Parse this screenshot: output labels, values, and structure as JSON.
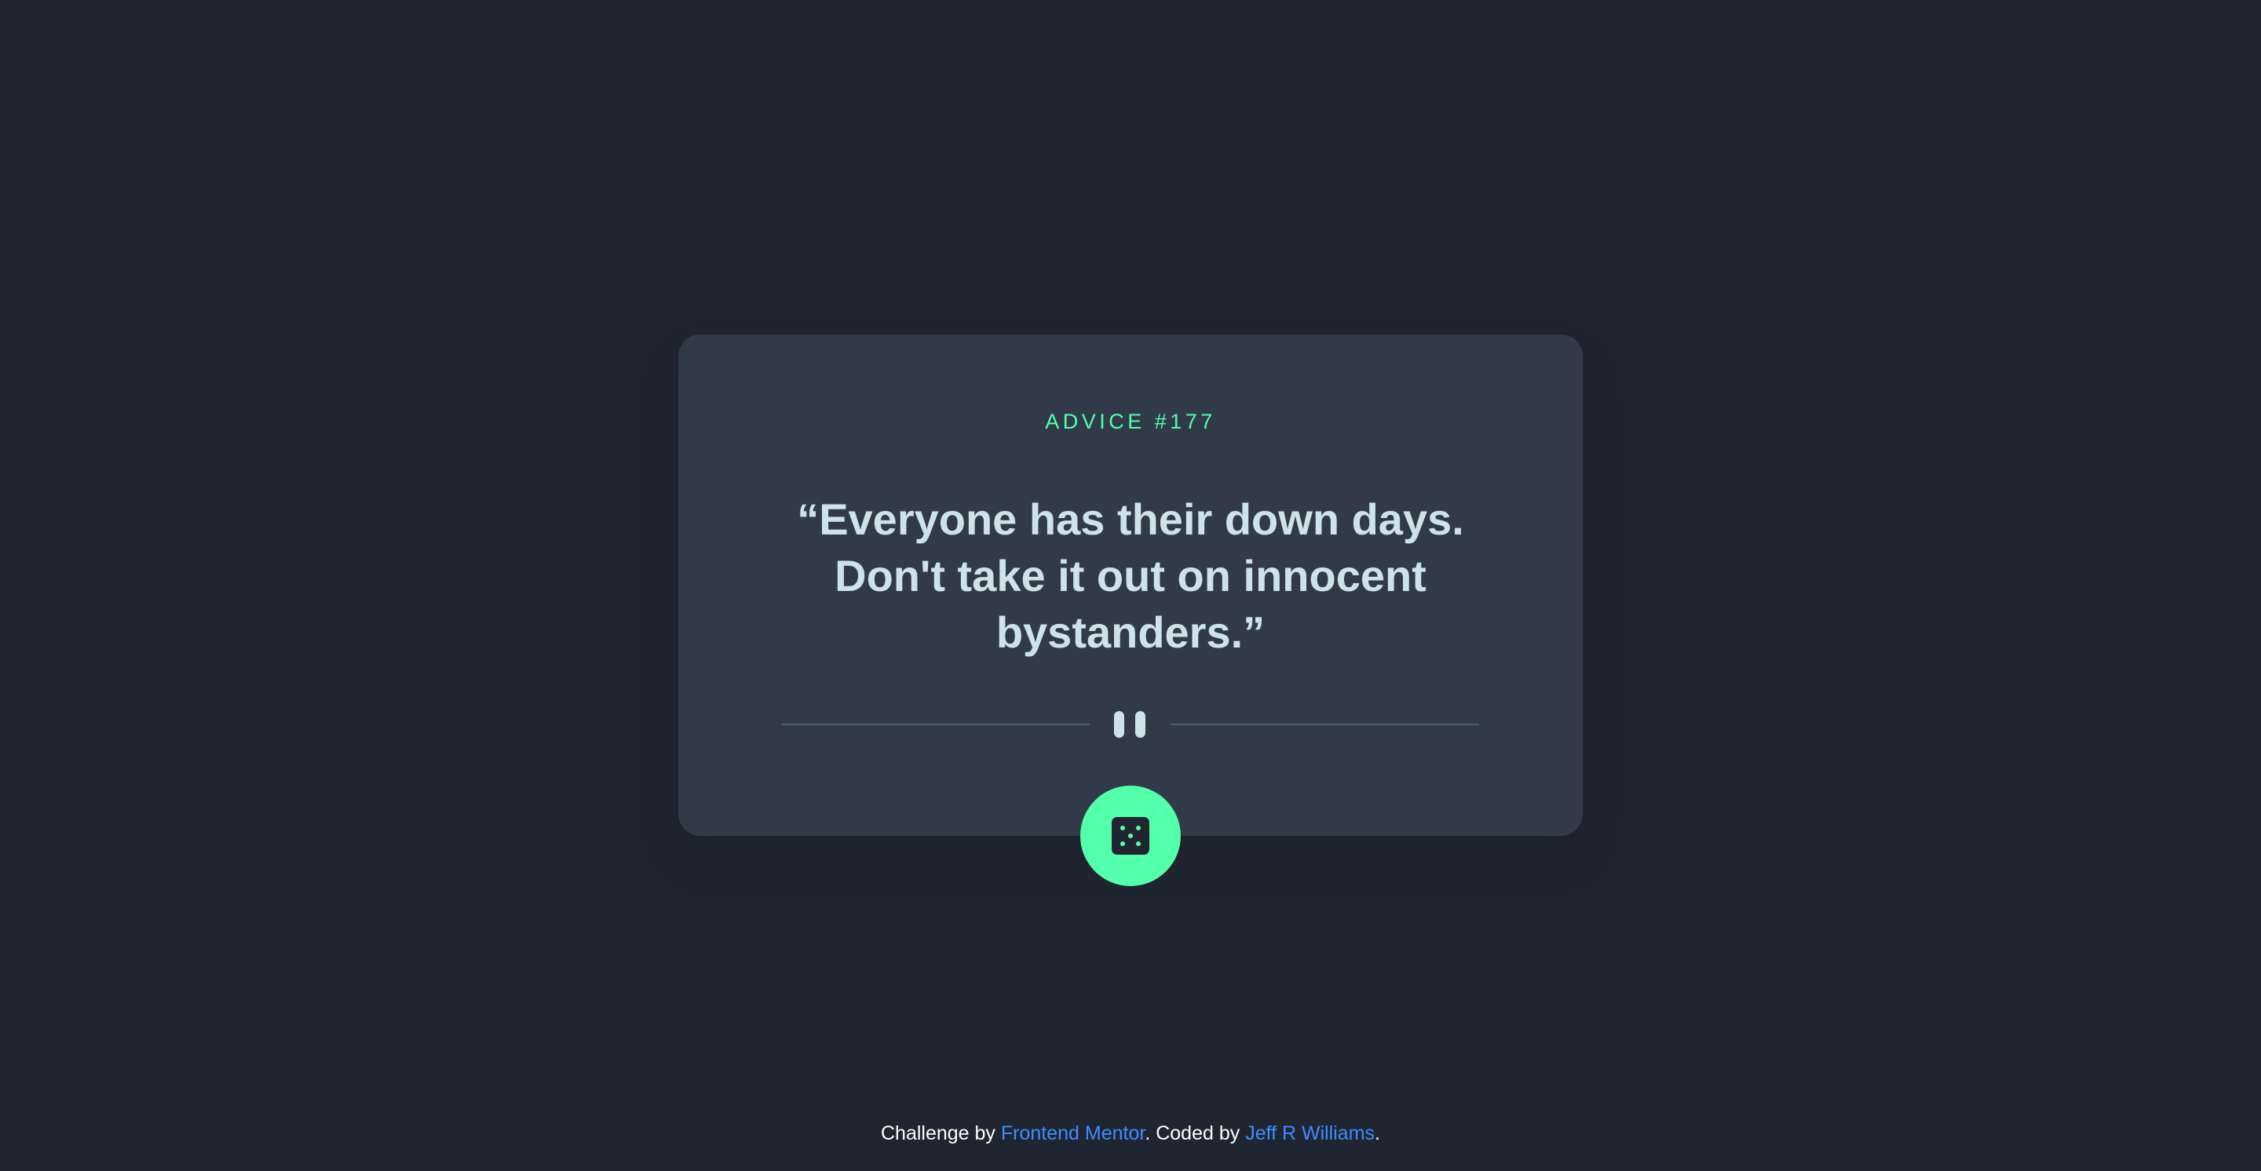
{
  "card": {
    "advice_id": "ADVICE #177",
    "quote": "“Everyone has their down days. Don't take it out on innocent bystanders.”"
  },
  "icons": {
    "divider": "pause-divider-icon",
    "button": "dice-icon"
  },
  "footer": {
    "prefix": "Challenge by ",
    "link1": "Frontend Mentor",
    "middle": ". Coded by ",
    "link2": "Jeff R Williams",
    "suffix": "."
  },
  "colors": {
    "background": "#1f2632",
    "card": "#313a49",
    "accent": "#53ffaa",
    "quote_text": "#cee3e9",
    "link": "#3e8cff",
    "divider_line": "#4f5d74"
  }
}
